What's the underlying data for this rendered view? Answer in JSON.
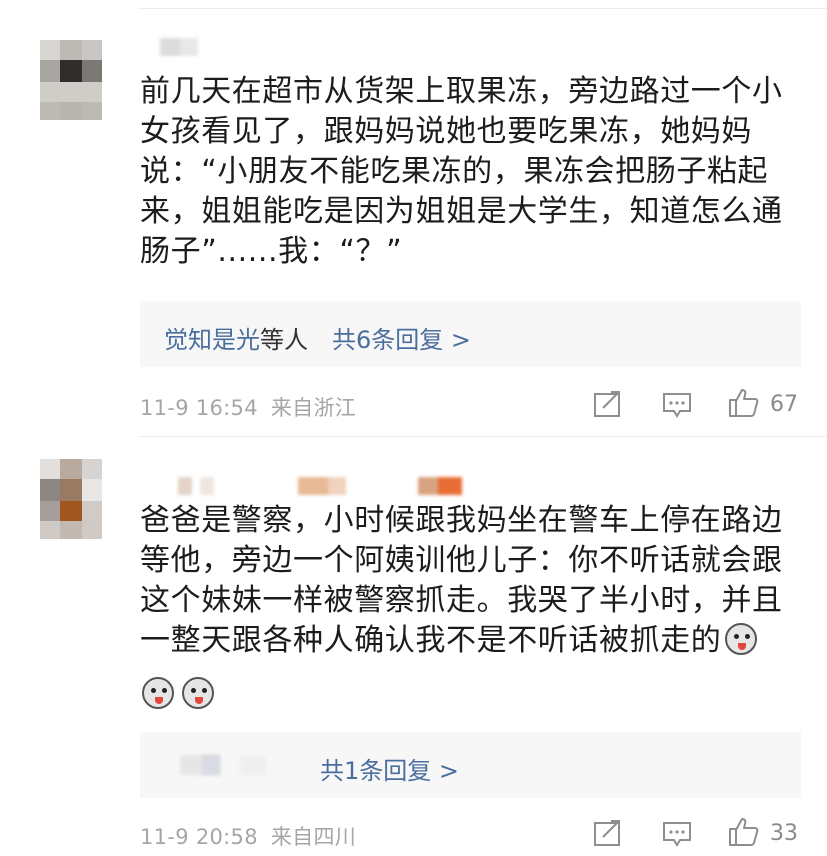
{
  "comments": [
    {
      "text": "前几天在超市从货架上取果冻，旁边路过一个小女孩看见了，跟妈妈说她也要吃果冻，她妈妈说：“小朋友不能吃果冻的，果冻会把肠子粘起来，姐姐能吃是因为姐姐是大学生，知道怎么通肠子”......我：“？”",
      "replies": {
        "names": "觉知是光",
        "names_suffix": "等人",
        "count_label": "共6条回复 >"
      },
      "time": "11-9 16:54",
      "location": "来自浙江",
      "likes": "67"
    },
    {
      "text": "爸爸是警察，小时候跟我妈坐在警车上停在路边等他，旁边一个阿姨训他儿子：你不听话就会跟这个妹妹一样被警察抓走。我哭了半小时，并且一整天跟各种人确认我不是不听话被抓走的",
      "replies": {
        "count_label": "共1条回复 >"
      },
      "time": "11-9 20:58",
      "location": "来自四川",
      "likes": "33",
      "emoji": "husky-emoji"
    }
  ],
  "icons": {
    "share": "share-icon",
    "comment": "comment-icon",
    "like": "thumbs-up-icon"
  }
}
